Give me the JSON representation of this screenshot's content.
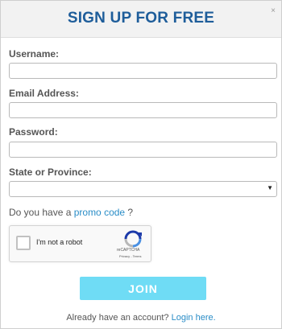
{
  "modal": {
    "title": "SIGN UP FOR FREE",
    "close_glyph": "×"
  },
  "form": {
    "username_label": "Username:",
    "username_value": "",
    "email_label": "Email Address:",
    "email_value": "",
    "password_label": "Password:",
    "password_value": "",
    "state_label": "State or Province:",
    "state_selected": "",
    "promo_prefix": "Do you have a ",
    "promo_link": "promo code",
    "promo_suffix": " ?"
  },
  "captcha": {
    "checkbox_label": "I'm not a robot",
    "brand": "reCAPTCHA",
    "terms": "Privacy - Terms",
    "icon": "recaptcha-logo-icon"
  },
  "join_button": "JOIN",
  "footer": {
    "prefix": "Already have an account? ",
    "login_link": "Login here."
  },
  "colors": {
    "title": "#1e5d9a",
    "join_button": "#6fdcf5",
    "link": "#2a8dc7"
  }
}
